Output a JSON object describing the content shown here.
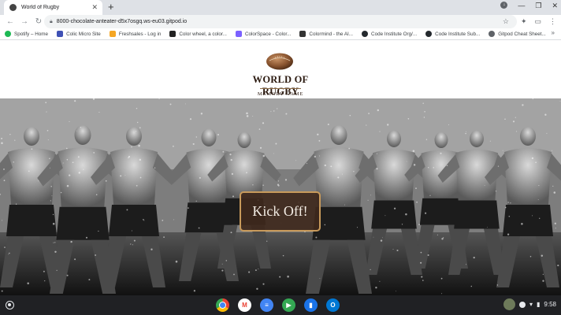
{
  "browser": {
    "tab": {
      "title": "World of Rugby",
      "close": "✕"
    },
    "new_tab": "+",
    "window_controls": [
      "●",
      "—",
      "❐",
      "✕"
    ],
    "nav": {
      "back": "←",
      "forward": "→",
      "reload": "↻"
    },
    "omnibox": {
      "url": "8000-chocolate-anteater-d5x7osgq.ws-eu03.gitpod.io",
      "star": "☆"
    },
    "toolbar_right": [
      "✦",
      "▭",
      "⋮"
    ],
    "bookmarks": [
      {
        "label": "Spotify – Home",
        "icon": "spotify-icon",
        "color": "#1db954"
      },
      {
        "label": "Colic Micro Site",
        "icon": "page-icon",
        "color": "#3f51b5"
      },
      {
        "label": "Freshsales - Log in",
        "icon": "freshsales-icon",
        "color": "#f5a623"
      },
      {
        "label": "Color wheel, a color...",
        "icon": "color-wheel-icon",
        "color": "#222222"
      },
      {
        "label": "ColorSpace - Color...",
        "icon": "colorspace-icon",
        "color": "#7b61ff"
      },
      {
        "label": "Colormind - the AI...",
        "icon": "colormind-icon",
        "color": "#333333"
      },
      {
        "label": "Code Institute Org/...",
        "icon": "github-icon",
        "color": "#24292e"
      },
      {
        "label": "Code Institute Sub...",
        "icon": "github-icon",
        "color": "#24292e"
      },
      {
        "label": "Gitpod Cheat Sheet...",
        "icon": "globe-icon",
        "color": "#5f6368"
      }
    ],
    "bookmarks_more": "»"
  },
  "page": {
    "logo_title": "WORLD OF RUGBY",
    "logo_subtitle": "MEMORY GAME",
    "kick_off": "Kick Off!"
  },
  "shelf": {
    "apps": [
      {
        "name": "chrome-app",
        "glyph": "",
        "color": "#ea4335"
      },
      {
        "name": "gmail-app",
        "glyph": "M",
        "color": "#ffffff"
      },
      {
        "name": "docs-app",
        "glyph": "≡",
        "color": "#4285f4"
      },
      {
        "name": "play-store-app",
        "glyph": "▶",
        "color": "#34a853"
      },
      {
        "name": "files-app",
        "glyph": "▮",
        "color": "#1a73e8"
      },
      {
        "name": "outlook-app",
        "glyph": "O",
        "color": "#0078d4"
      }
    ],
    "time": "9:58"
  },
  "colors": {
    "button_bg": "#3e281c",
    "button_border": "#c89a5b",
    "shelf": "#202124"
  }
}
